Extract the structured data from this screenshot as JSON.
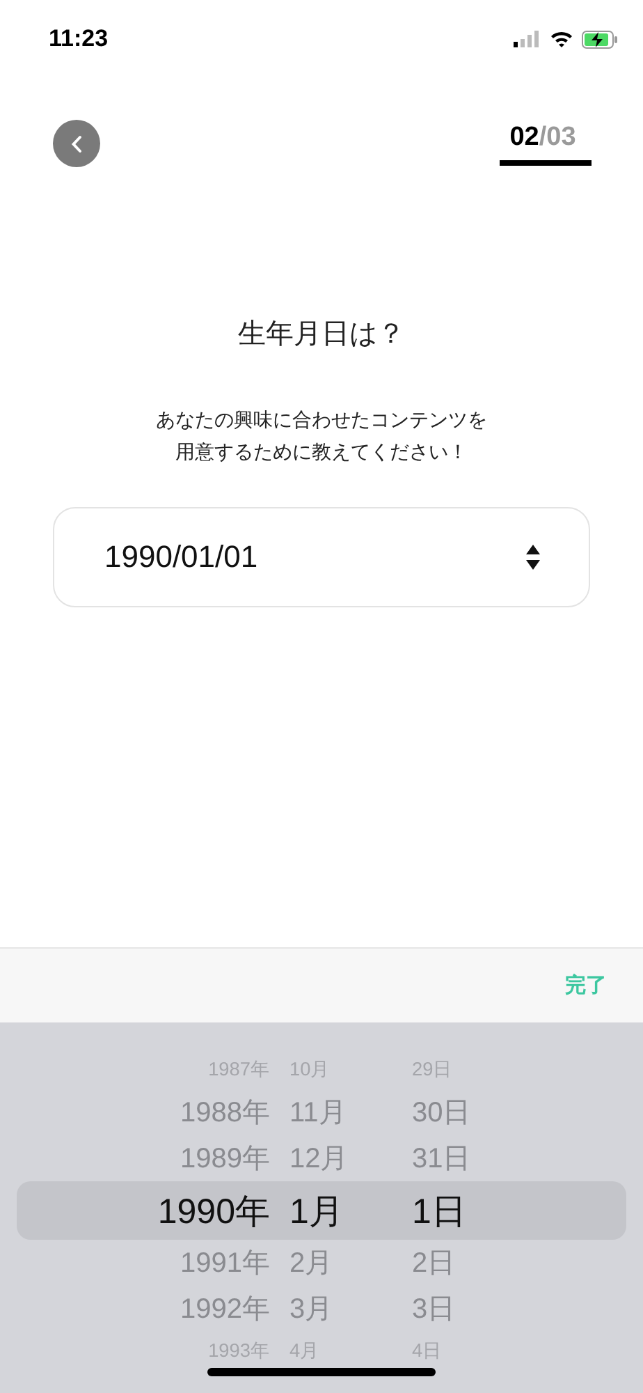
{
  "status_bar": {
    "time": "11:23"
  },
  "header": {
    "progress": {
      "current": "02",
      "rest": "/03"
    }
  },
  "title": "生年月日は？",
  "subtitle": [
    "あなたの興味に合わせたコンテンツを",
    "用意するために教えてください！"
  ],
  "date_field": {
    "value": "1990/01/01"
  },
  "toolbar": {
    "done": "完了"
  },
  "picker": {
    "rows": [
      {
        "year": "1987年",
        "month": "10月",
        "day": "29日",
        "selected": false
      },
      {
        "year": "1988年",
        "month": "11月",
        "day": "30日",
        "selected": false
      },
      {
        "year": "1989年",
        "month": "12月",
        "day": "31日",
        "selected": false
      },
      {
        "year": "1990年",
        "month": "1月",
        "day": "1日",
        "selected": true
      },
      {
        "year": "1991年",
        "month": "2月",
        "day": "2日",
        "selected": false
      },
      {
        "year": "1992年",
        "month": "3月",
        "day": "3日",
        "selected": false
      },
      {
        "year": "1993年",
        "month": "4月",
        "day": "4日",
        "selected": false
      }
    ]
  }
}
